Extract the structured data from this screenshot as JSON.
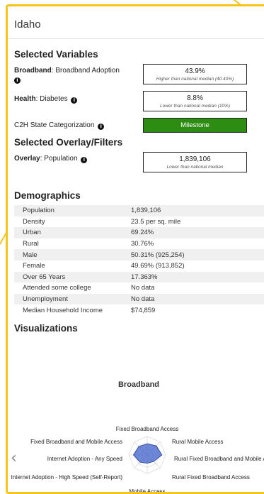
{
  "panel": {
    "title": "Idaho"
  },
  "selected_variables": {
    "heading": "Selected Variables",
    "broadband": {
      "name": "Broadband",
      "detail": ": Broadband Adoption",
      "value": "43.9%",
      "note": "Higher than national median (40.40%)"
    },
    "health": {
      "name": "Health",
      "detail": ": Diabetes",
      "value": "8.8%",
      "note": "Lower than national median (10%)"
    },
    "c2h": {
      "label": "C2H State Categorization",
      "value": "Milestone",
      "color": "#2d8c12"
    }
  },
  "overlay": {
    "heading": "Selected Overlay/Filters",
    "name": "Overlay",
    "detail": ": Population",
    "value": "1,839,106",
    "note": "Lower than national median"
  },
  "demographics": {
    "heading": "Demographics",
    "rows": [
      {
        "label": "Population",
        "value": "1,839,106"
      },
      {
        "label": "Density",
        "value": "23.5 per sq. mile"
      },
      {
        "label": "Urban",
        "value": "69.24%"
      },
      {
        "label": "Rural",
        "value": "30.76%"
      },
      {
        "label": "Male",
        "value": "50.31% (925,254)"
      },
      {
        "label": "Female",
        "value": "49.69% (913,852)"
      },
      {
        "label": "Over 65 Years",
        "value": "17.363%"
      },
      {
        "label": "Attended some college",
        "value": "No data"
      },
      {
        "label": "Unemployment",
        "value": "No data"
      },
      {
        "label": "Median Household Income",
        "value": "$74,859"
      }
    ]
  },
  "visualizations": {
    "heading": "Visualizations",
    "chart_title": "Broadband",
    "axes": [
      "Fixed Broadband Access",
      "Rural Mobile Access",
      "Rural Fixed Broadband and Mobile Access",
      "Rural Fixed Broadband Access",
      "Mobile Access",
      "Internet Adoption - High Speed (Self-Report)",
      "Internet Adoption - Any Speed",
      "Fixed Broadband and Mobile Access"
    ],
    "prev_icon": "chevron-left-icon",
    "accent": "#f5c518",
    "fill": "#3d5fc8"
  }
}
